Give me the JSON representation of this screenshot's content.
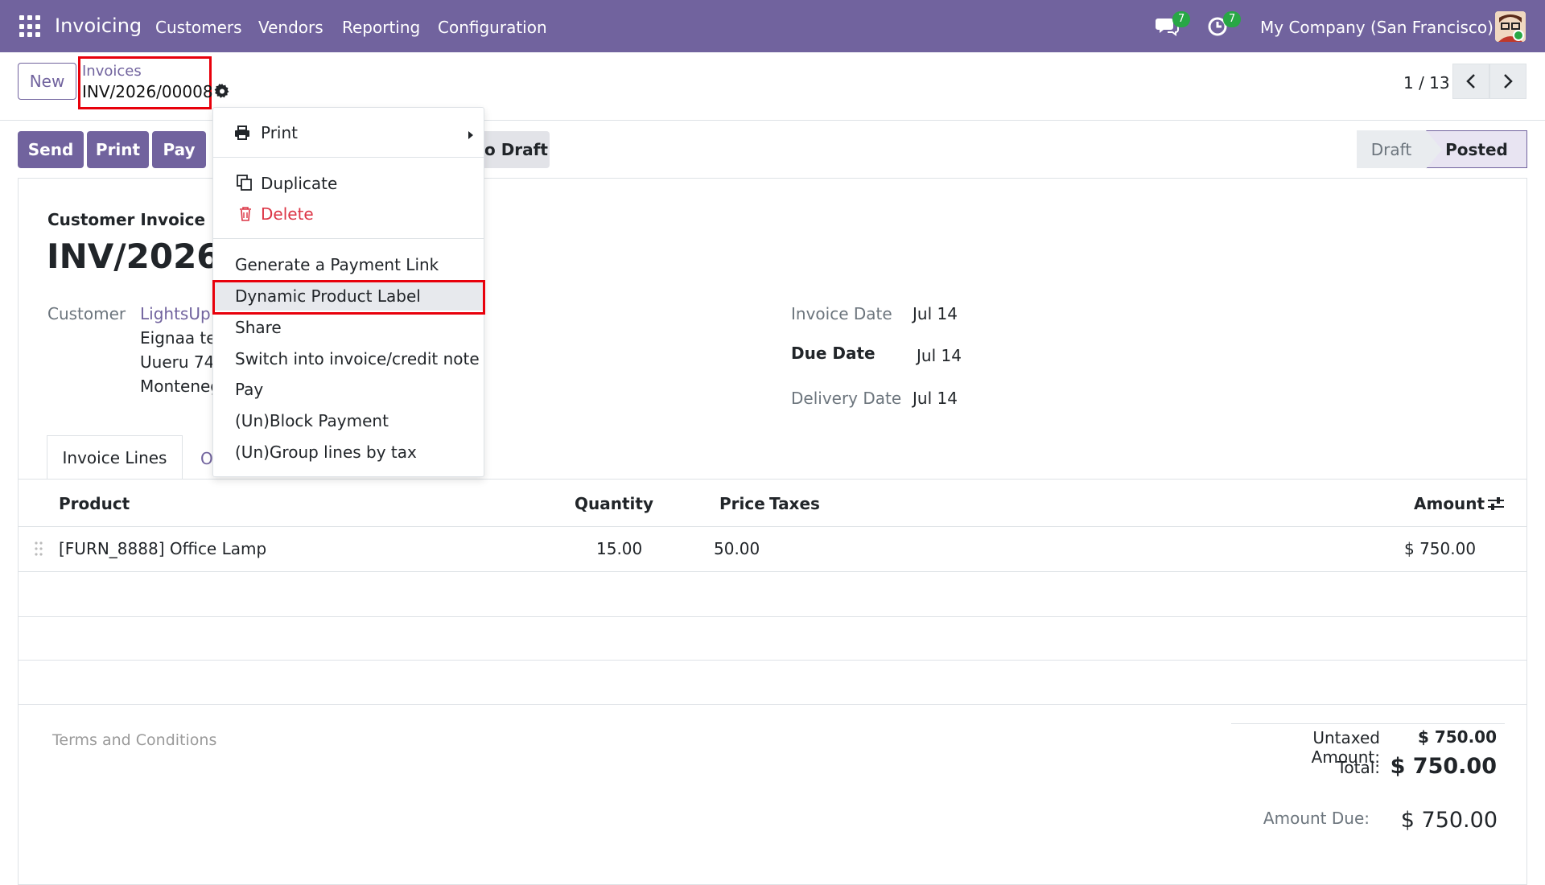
{
  "navbar": {
    "app_name": "Invoicing",
    "menu": [
      "Customers",
      "Vendors",
      "Reporting",
      "Configuration"
    ],
    "messages_count": "7",
    "activities_count": "7",
    "company": "My Company (San Francisco)"
  },
  "control_panel": {
    "new_label": "New",
    "breadcrumb_parent": "Invoices",
    "breadcrumb_current": "INV/2026/00008",
    "pager": "1 / 13"
  },
  "actions": {
    "send": "Send",
    "print": "Print",
    "pay": "Pay",
    "reset_draft_partial": "o Draft"
  },
  "status": {
    "draft": "Draft",
    "posted": "Posted"
  },
  "invoice": {
    "type": "Customer Invoice",
    "name_partial": "INV/2026/0",
    "customer_label": "Customer",
    "customer_name_partial": "LightsUp",
    "address_lines": [
      "Eignaa te",
      "Uueru 74",
      "Monteneg"
    ],
    "invoice_date_label": "Invoice Date",
    "invoice_date": "Jul 14",
    "due_date_label": "Due Date",
    "due_date": "Jul 14",
    "delivery_date_label": "Delivery Date",
    "delivery_date": "Jul 14"
  },
  "tabs": {
    "active": "Invoice Lines",
    "other_partial": "O"
  },
  "lines": {
    "headers": {
      "product": "Product",
      "quantity": "Quantity",
      "price": "Price",
      "taxes": "Taxes",
      "amount": "Amount"
    },
    "rows": [
      {
        "product": "[FURN_8888] Office Lamp",
        "quantity": "15.00",
        "price": "50.00",
        "taxes": "",
        "amount": "$ 750.00"
      }
    ]
  },
  "footer": {
    "terms_placeholder": "Terms and Conditions",
    "untaxed_label": "Untaxed Amount:",
    "untaxed_value": "$ 750.00",
    "total_label": "Total:",
    "total_value": "$ 750.00",
    "amount_due_label": "Amount Due:",
    "amount_due_value": "$ 750.00"
  },
  "dropdown": {
    "print": "Print",
    "duplicate": "Duplicate",
    "delete": "Delete",
    "generate_payment_link": "Generate a Payment Link",
    "dynamic_product_label": "Dynamic Product Label",
    "share": "Share",
    "switch_invoice": "Switch into invoice/credit note",
    "pay": "Pay",
    "block_payment": "(Un)Block Payment",
    "group_lines": "(Un)Group lines by tax"
  },
  "colors": {
    "brand": "#71639e",
    "highlight_box": "#e8000b",
    "badge": "#28a745"
  }
}
